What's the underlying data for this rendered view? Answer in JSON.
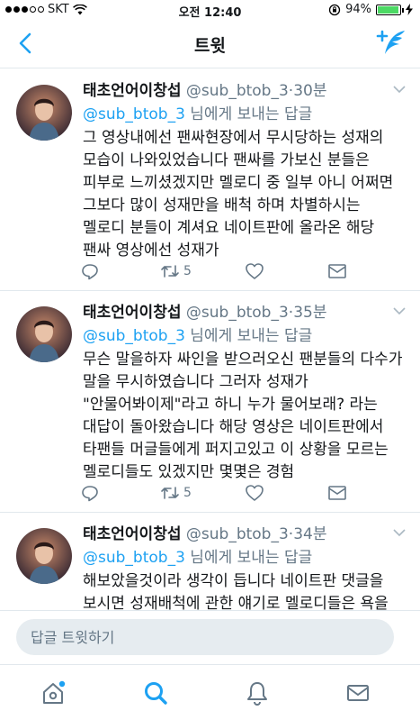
{
  "status_bar": {
    "carrier": "SKT",
    "time": "오전 12:40",
    "battery": "94%",
    "battery_level": 0.94,
    "signal_bars_filled": 3,
    "signal_bars_total": 5
  },
  "nav": {
    "title": "트윗"
  },
  "colors": {
    "accent": "#1da1f2",
    "secondary_text": "#657786",
    "divider": "#e1e8ed"
  },
  "tweets": [
    {
      "name": "태초언어이창섭",
      "handle": "@sub_btob_3",
      "sep": "·",
      "ago": "30분",
      "reply_mention": "@sub_btob_3",
      "reply_suffix": " 님에게 보내는 답글",
      "text": "그 영상내에선 팬싸현장에서 무시당하는 성재의 모습이 나와있었습니다 팬싸를 가보신 분들은 피부로 느끼셨겠지만 멜로디 중 일부 아니 어쩌면 그보다 많이 성재만을 배척 하며 차별하시는 멜로디 분들이 계셔요 네이트판에 올라온 해당 팬싸 영상에선 성재가",
      "retweets": "5"
    },
    {
      "name": "태초언어이창섭",
      "handle": "@sub_btob_3",
      "sep": "·",
      "ago": "35분",
      "reply_mention": "@sub_btob_3",
      "reply_suffix": " 님에게 보내는 답글",
      "text": "무슨 말을하자 싸인을 받으러오신 팬분들의 다수가 말을 무시하였습니다 그러자 성재가 \"안물어봐이제\"라고 하니 누가 물어보래? 라는 대답이 돌아왔습니다 해당 영상은 네이트판에서 타팬들 머글들에게 퍼지고있고 이 상황을 모르는 멜로디들도 있겠지만 몇몇은 경험",
      "retweets": "5"
    },
    {
      "name": "태초언어이창섭",
      "handle": "@sub_btob_3",
      "sep": "·",
      "ago": "34분",
      "reply_mention": "@sub_btob_3",
      "reply_suffix": " 님에게 보내는 답글",
      "text": "해보았을것이라 생각이 듭니다 네이트판 댓글을 보시면 성재배척에 관한 얘기로 멜로디들은 욕을",
      "retweets": ""
    }
  ],
  "reply_bar": {
    "placeholder": "답글 트윗하기"
  },
  "tab_bar": {
    "items": [
      "home-icon",
      "search-icon",
      "notifications-icon",
      "messages-icon"
    ],
    "home_has_dot": true
  }
}
